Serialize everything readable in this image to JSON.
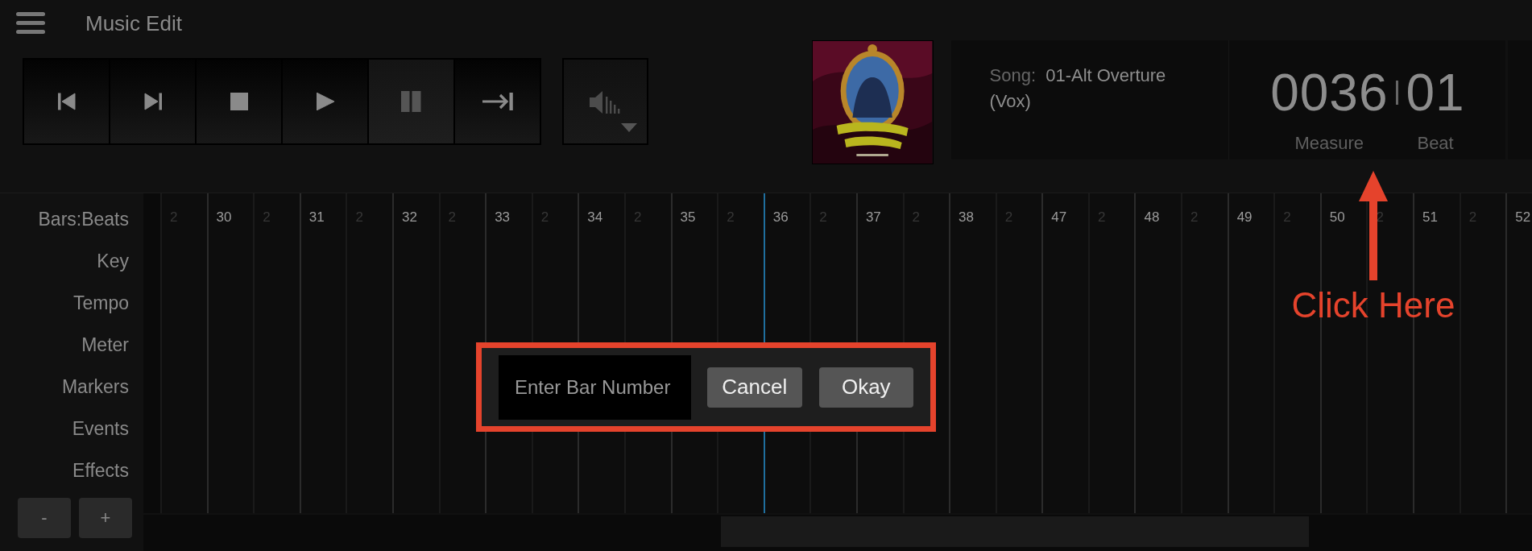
{
  "header": {
    "title": "Music Edit"
  },
  "transport": [
    {
      "kind": "skip-back",
      "selected": false
    },
    {
      "kind": "skip-forward",
      "selected": false
    },
    {
      "kind": "stop",
      "selected": false
    },
    {
      "kind": "play",
      "selected": false
    },
    {
      "kind": "pause",
      "selected": true
    },
    {
      "kind": "to-end",
      "selected": false
    }
  ],
  "song": {
    "label": "Song:",
    "title": "01-Alt Overture (Vox)"
  },
  "counter": {
    "measure": "0036",
    "beat": "01",
    "measure_label": "Measure",
    "beat_label": "Beat"
  },
  "tracks": [
    "Bars:Beats",
    "Key",
    "Tempo",
    "Meter",
    "Markers",
    "Events",
    "Effects"
  ],
  "zoom_buttons": [
    "-",
    "+"
  ],
  "ruler": [
    {
      "label": "2",
      "kind": "beat",
      "selected": false
    },
    {
      "label": "30",
      "kind": "bar",
      "selected": false
    },
    {
      "label": "2",
      "kind": "beat",
      "selected": false
    },
    {
      "label": "31",
      "kind": "bar",
      "selected": false
    },
    {
      "label": "2",
      "kind": "beat",
      "selected": false
    },
    {
      "label": "32",
      "kind": "bar",
      "selected": false
    },
    {
      "label": "2",
      "kind": "beat",
      "selected": false
    },
    {
      "label": "33",
      "kind": "bar",
      "selected": false
    },
    {
      "label": "2",
      "kind": "beat",
      "selected": false
    },
    {
      "label": "34",
      "kind": "bar",
      "selected": false
    },
    {
      "label": "2",
      "kind": "beat",
      "selected": false
    },
    {
      "label": "35",
      "kind": "bar",
      "selected": false
    },
    {
      "label": "2",
      "kind": "beat",
      "selected": false
    },
    {
      "label": "36",
      "kind": "bar",
      "selected": true
    },
    {
      "label": "2",
      "kind": "beat",
      "selected": false
    },
    {
      "label": "37",
      "kind": "bar",
      "selected": false
    },
    {
      "label": "2",
      "kind": "beat",
      "selected": false
    },
    {
      "label": "38",
      "kind": "bar",
      "selected": false
    },
    {
      "label": "2",
      "kind": "beat",
      "selected": false
    },
    {
      "label": "47",
      "kind": "bar",
      "selected": false
    },
    {
      "label": "2",
      "kind": "beat",
      "selected": false
    },
    {
      "label": "48",
      "kind": "bar",
      "selected": false
    },
    {
      "label": "2",
      "kind": "beat",
      "selected": false
    },
    {
      "label": "49",
      "kind": "bar",
      "selected": false
    },
    {
      "label": "2",
      "kind": "beat",
      "selected": false
    },
    {
      "label": "50",
      "kind": "bar",
      "selected": false
    },
    {
      "label": "2",
      "kind": "beat",
      "selected": false
    },
    {
      "label": "51",
      "kind": "bar",
      "selected": false
    },
    {
      "label": "2",
      "kind": "beat",
      "selected": false
    },
    {
      "label": "52",
      "kind": "bar",
      "selected": false
    }
  ],
  "dialog": {
    "placeholder": "Enter Bar Number",
    "buttons": [
      "Cancel",
      "Okay"
    ]
  },
  "annotation": {
    "text": "Click Here"
  }
}
